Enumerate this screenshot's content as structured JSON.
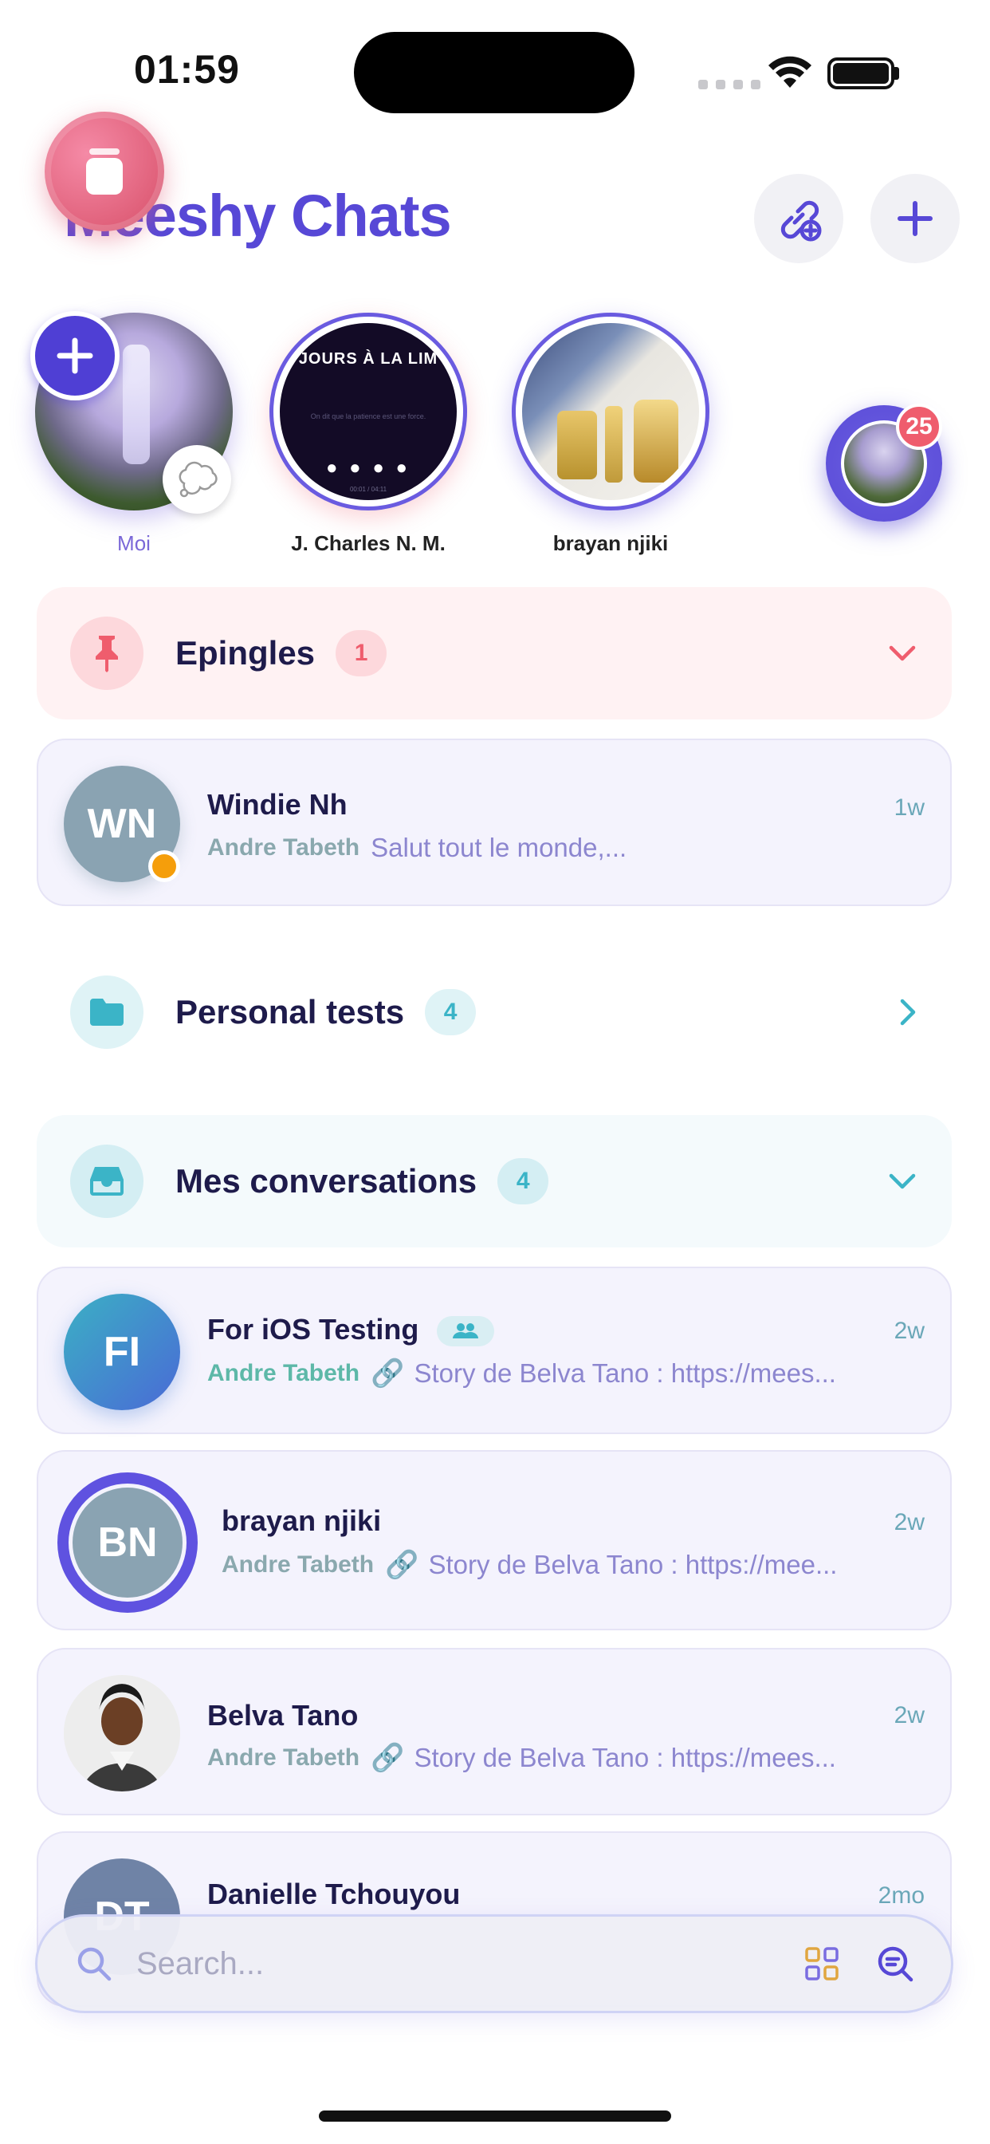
{
  "status_bar": {
    "time": "01:59"
  },
  "header": {
    "title": "Meeshy Chats"
  },
  "stories": [
    {
      "label": "Moi"
    },
    {
      "label": "J. Charles N. M.",
      "thumb_text": "JOURS À LA LIM",
      "thumb_caption": "On dit que la patience est une force.",
      "thumb_progress": "00:01 / 04:11"
    },
    {
      "label": "brayan njiki"
    }
  ],
  "floating_story": {
    "badge": "25"
  },
  "sections": {
    "pinned": {
      "title": "Epingles",
      "count": "1",
      "accent": "#ef5d6d"
    },
    "personal": {
      "title": "Personal tests",
      "count": "4",
      "accent": "#3bb4c7"
    },
    "mine": {
      "title": "Mes conversations",
      "count": "4",
      "accent": "#3bb4c7"
    }
  },
  "pinned_chats": [
    {
      "initials": "WN",
      "name": "Windie Nh",
      "time": "1w",
      "sender": "Andre Tabeth",
      "preview": "Salut tout le monde,...",
      "status_color": "#f59e0b"
    }
  ],
  "chats": [
    {
      "initials": "FI",
      "name": "For iOS Testing",
      "time": "2w",
      "sender": "Andre Tabeth",
      "preview": "Story de Belva Tano : https://mees..."
    },
    {
      "initials": "BN",
      "name": "brayan njiki",
      "time": "2w",
      "sender": "Andre Tabeth",
      "preview": "Story de Belva Tano : https://mee..."
    },
    {
      "initials": "",
      "name": "Belva Tano",
      "time": "2w",
      "sender": "Andre Tabeth",
      "preview": "Story de Belva Tano : https://mees..."
    },
    {
      "initials": "DT",
      "name": "Danielle Tchouyou",
      "time": "2mo"
    }
  ],
  "search": {
    "placeholder": "Search..."
  },
  "colors": {
    "brand": "#5748d6",
    "accent_teal": "#3bb4c7",
    "accent_red": "#ef5d6d"
  }
}
